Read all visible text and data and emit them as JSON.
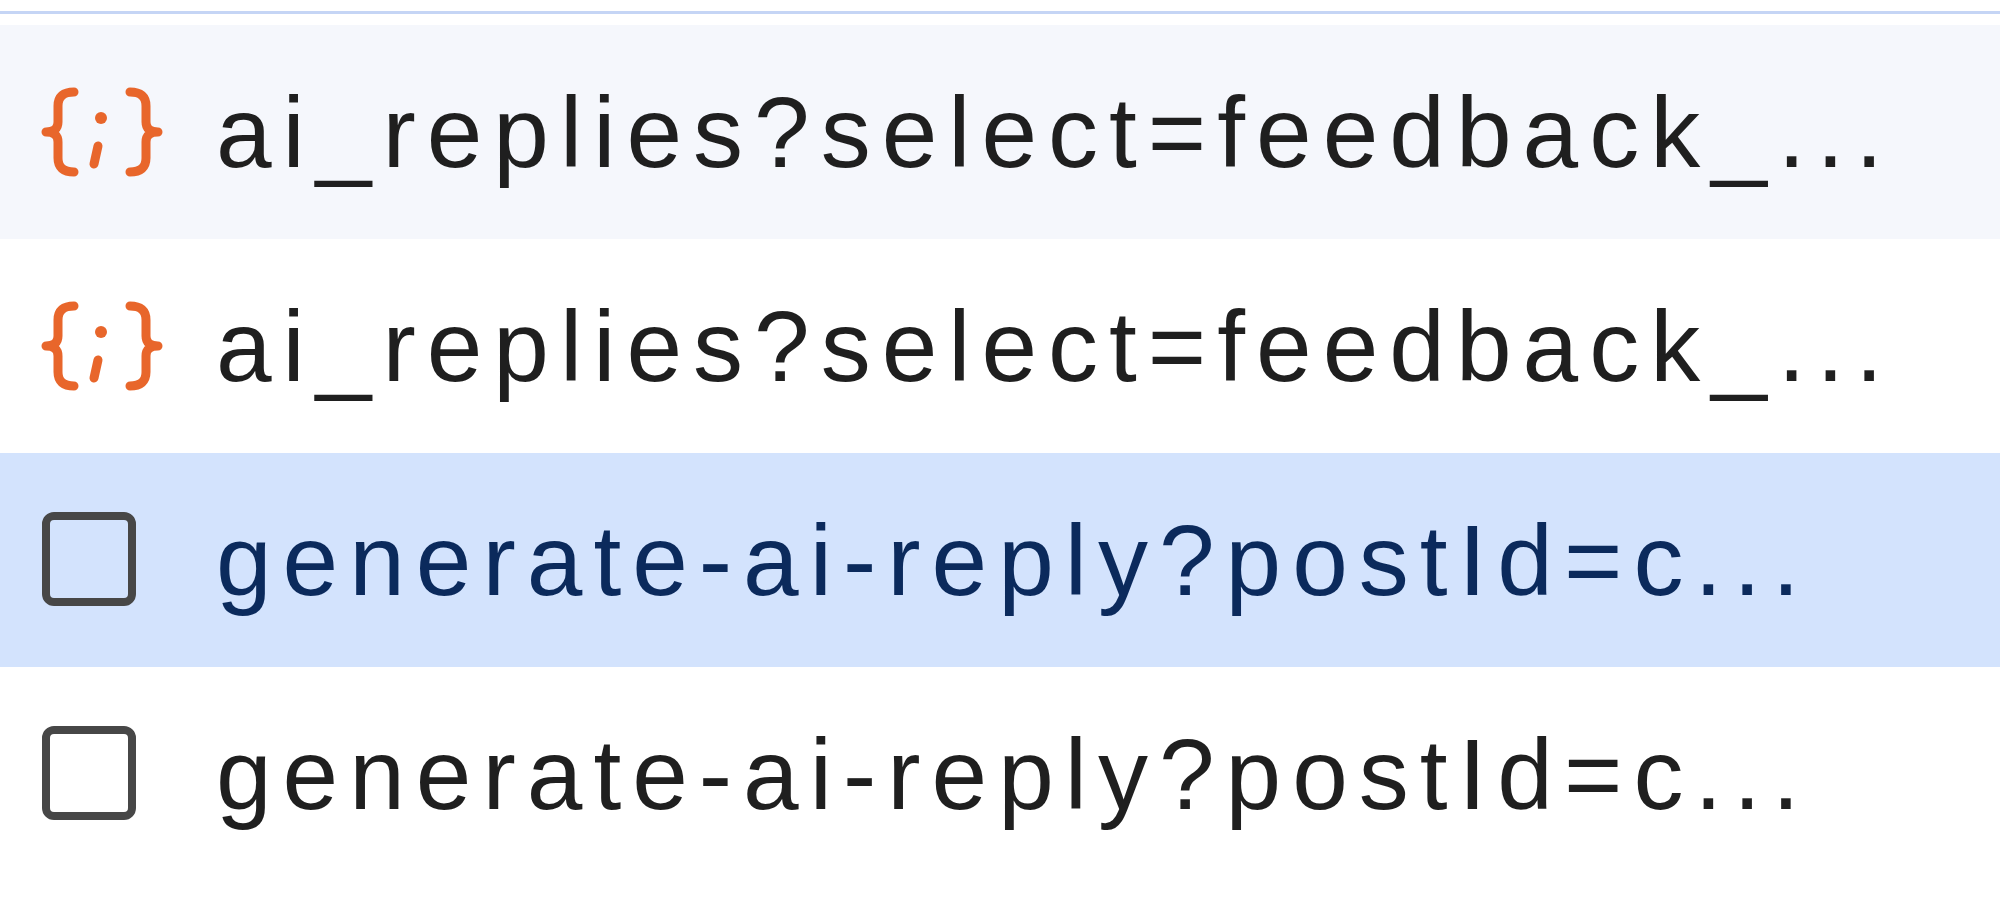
{
  "requests": [
    {
      "kind": "fetch",
      "name": "ai_replies?select=feedback_...",
      "selected": false
    },
    {
      "kind": "fetch",
      "name": "ai_replies?select=feedback_...",
      "selected": false
    },
    {
      "kind": "document",
      "name": "generate-ai-reply?postId=c...",
      "selected": true
    },
    {
      "kind": "document",
      "name": "generate-ai-reply?postId=c...",
      "selected": false
    }
  ]
}
